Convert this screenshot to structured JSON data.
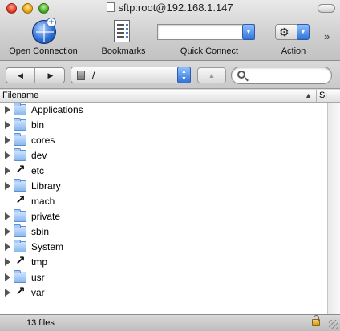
{
  "window": {
    "title": "sftp:root@192.168.1.147"
  },
  "toolbar": {
    "open_connection_label": "Open Connection",
    "bookmarks_label": "Bookmarks",
    "quick_connect_label": "Quick Connect",
    "quick_connect_value": "",
    "action_label": "Action",
    "overflow_glyph": "»"
  },
  "navbar": {
    "back_glyph": "◀",
    "forward_glyph": "▶",
    "path": "/",
    "up_glyph": "▲",
    "search_value": ""
  },
  "table": {
    "columns": {
      "filename": "Filename",
      "size": "Si"
    },
    "sort_glyph": "▲",
    "rows": [
      {
        "name": "Applications",
        "kind": "folder",
        "expandable": true
      },
      {
        "name": "bin",
        "kind": "folder",
        "expandable": true
      },
      {
        "name": "cores",
        "kind": "folder",
        "expandable": true
      },
      {
        "name": "dev",
        "kind": "folder",
        "expandable": true
      },
      {
        "name": "etc",
        "kind": "alias",
        "expandable": true
      },
      {
        "name": "Library",
        "kind": "folder",
        "expandable": true
      },
      {
        "name": "mach",
        "kind": "alias",
        "expandable": false
      },
      {
        "name": "private",
        "kind": "folder",
        "expandable": true
      },
      {
        "name": "sbin",
        "kind": "folder",
        "expandable": true
      },
      {
        "name": "System",
        "kind": "folder",
        "expandable": true
      },
      {
        "name": "tmp",
        "kind": "alias",
        "expandable": true
      },
      {
        "name": "usr",
        "kind": "folder",
        "expandable": true
      },
      {
        "name": "var",
        "kind": "alias",
        "expandable": true
      }
    ]
  },
  "status": {
    "file_count": "13 files"
  },
  "icons": {
    "alias_glyph": "↗",
    "gear_glyph": "⚙",
    "dropdown_glyph": "▼",
    "popup_glyph": "▲▼"
  }
}
